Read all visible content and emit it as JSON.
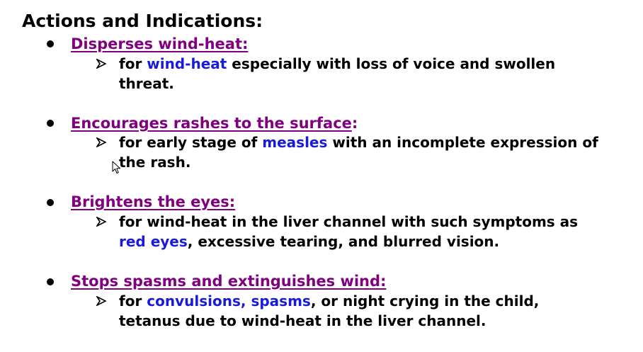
{
  "title": "Actions and Indications:",
  "items": [
    {
      "heading": "Disperses wind-heat:",
      "text": {
        "p1": "for ",
        "h1": "wind-heat",
        "p2": " especially with loss of voice and swollen threat."
      }
    },
    {
      "heading": "Encourages rashes to the surface",
      "heading_suffix": ":",
      "text": {
        "p1": "for early stage of ",
        "h1": "measles",
        "p2": " with an incomplete expression of the rash."
      }
    },
    {
      "heading": "Brightens the eyes:",
      "text": {
        "p1": "for wind-heat in the liver channel with such symptoms as ",
        "h1": "red eyes",
        "p2": ", excessive tearing, and blurred vision."
      }
    },
    {
      "heading": "Stops spasms and extinguishes wind:",
      "text": {
        "p1": "for ",
        "h1": "convulsions, spasms",
        "p2": ", or night crying in the child, tetanus due to wind-heat in the liver channel."
      }
    }
  ],
  "colors": {
    "heading": "#800080",
    "highlight": "#1a1adb",
    "text": "#000000"
  },
  "icons": {
    "bullet": "bullet-dot-icon",
    "sub_bullet": "arrowhead-icon",
    "cursor": "mouse-pointer-icon"
  }
}
